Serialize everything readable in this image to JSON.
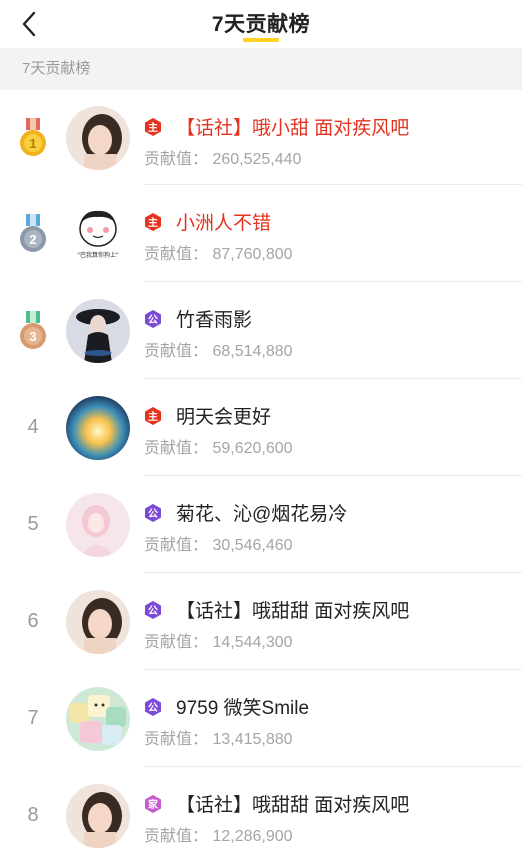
{
  "header": {
    "title": "7天贡献榜"
  },
  "section": {
    "label": "7天贡献榜"
  },
  "value_label": "贡献值：",
  "rows": [
    {
      "rank": "1",
      "name": "【话社】哦小甜 面对疾风吧",
      "value": "260,525,440",
      "badge": "host-badge-icon",
      "name_color": "#e5331f"
    },
    {
      "rank": "2",
      "name": "小洲人不错",
      "value": "87,760,800",
      "badge": "host-badge-icon",
      "name_color": "#e5331f"
    },
    {
      "rank": "3",
      "name": "竹香雨影",
      "value": "68,514,880",
      "badge": "guild-badge-icon",
      "name_color": "#222222"
    },
    {
      "rank": "4",
      "name": "明天会更好",
      "value": "59,620,600",
      "badge": "host-badge-icon",
      "name_color": "#222222"
    },
    {
      "rank": "5",
      "name": "菊花、沁@烟花易冷",
      "value": "30,546,460",
      "badge": "guild-badge-icon",
      "name_color": "#222222"
    },
    {
      "rank": "6",
      "name": "【话社】哦甜甜 面对疾风吧",
      "value": "14,544,300",
      "badge": "guild-badge-icon",
      "name_color": "#222222"
    },
    {
      "rank": "7",
      "name": "9759 微笑Smile",
      "value": "13,415,880",
      "badge": "guild-badge-icon",
      "name_color": "#222222"
    },
    {
      "rank": "8",
      "name": "【话社】哦甜甜 面对疾风吧",
      "value": "12,286,900",
      "badge": "guild-badge-pink-icon",
      "name_color": "#222222"
    }
  ],
  "avatar_captions": {
    "row2": "\"巴我算你狗上\""
  },
  "badge_text": {
    "host": "主",
    "guild": "公",
    "guild_pink": "家"
  },
  "colors": {
    "accent_yellow": "#ffd31f",
    "host_red": "#e5331f",
    "guild_purple": "#7c4ad8",
    "guild_pink": "#c65ad0",
    "gold": "#f2b21f",
    "silver": "#8c98a8",
    "bronze": "#d79a6f"
  }
}
